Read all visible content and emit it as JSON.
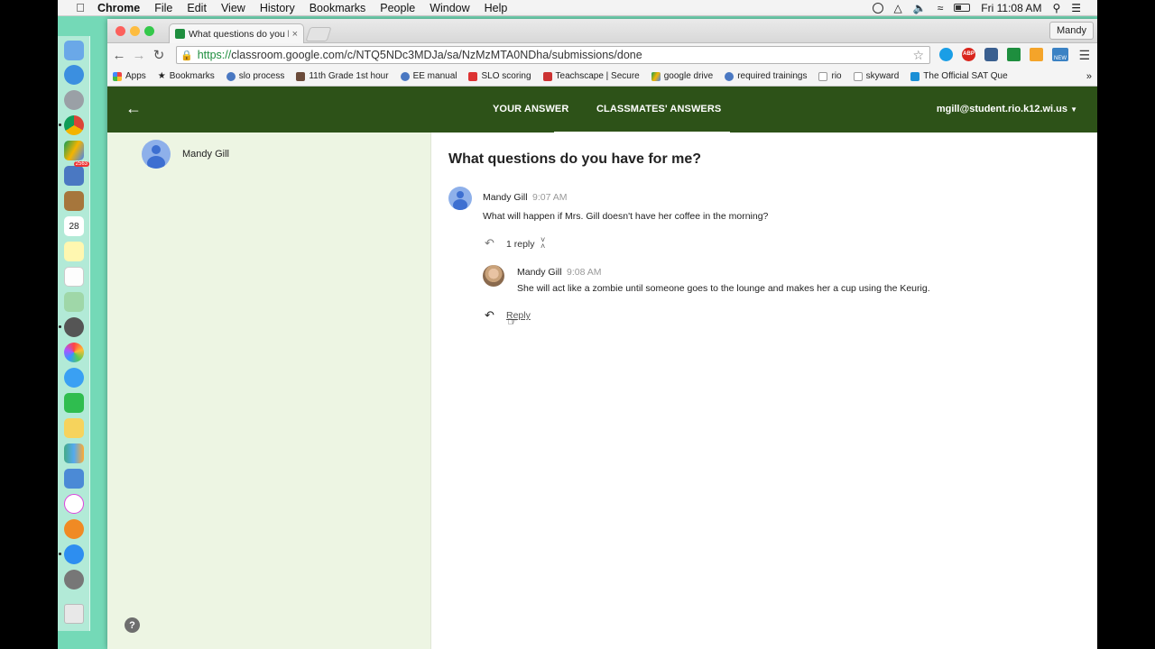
{
  "menubar": {
    "app": "Chrome",
    "items": [
      "File",
      "Edit",
      "View",
      "History",
      "Bookmarks",
      "People",
      "Window",
      "Help"
    ],
    "clock": "Fri 11:08 AM"
  },
  "dock": {
    "badge": "2563",
    "calendar_day": "28"
  },
  "browser": {
    "tab_title": "What questions do you hav",
    "profile": "Mandy",
    "url_scheme": "https://",
    "url_rest": "classroom.google.com/c/NTQ5NDc3MDJa/sa/NzMzMTA0NDha/submissions/done",
    "bookmarks": [
      "Apps",
      "Bookmarks",
      "slo process",
      "11th Grade 1st hour",
      "EE manual",
      "SLO scoring",
      "Teachscape | Secure",
      "google drive",
      "required trainings",
      "rio",
      "skyward",
      "The Official SAT Que"
    ],
    "bookmarks_more": "»",
    "extensions": {
      "abp": "ABP",
      "new": "NEW"
    }
  },
  "classroom": {
    "tab_your_answer": "YOUR ANSWER",
    "tab_classmates": "CLASSMATES' ANSWERS",
    "account": "mgill@student.rio.k12.wi.us",
    "left_person": "Mandy Gill",
    "question": "What questions do you have for me?",
    "comment": {
      "author": "Mandy Gill",
      "time": "9:07 AM",
      "text": "What will happen if Mrs. Gill doesn't have her coffee in the morning?",
      "reply_count": "1 reply"
    },
    "reply": {
      "author": "Mandy Gill",
      "time": "9:08 AM",
      "text": "She will act like a zombie until someone goes to the lounge and makes her a cup using the Keurig."
    },
    "reply_link": "Reply",
    "help": "?"
  },
  "colors": {
    "header": "#2d5218",
    "left_pane": "#edf5e3",
    "desktop": "#74d9b7"
  }
}
